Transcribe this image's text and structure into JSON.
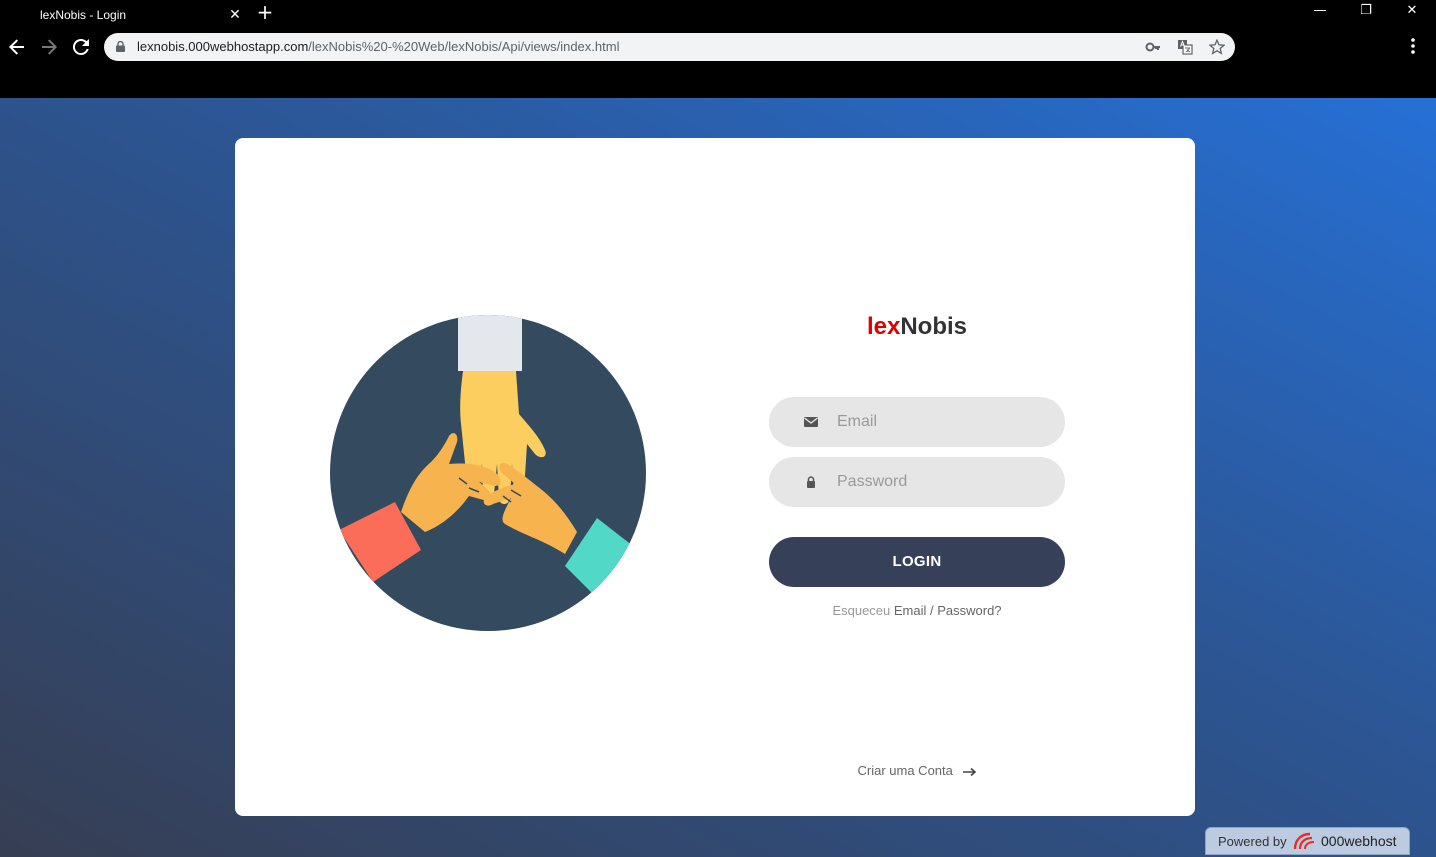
{
  "browser": {
    "tab_title": "lexNobis - Login",
    "tab_close": "✕",
    "new_tab": "+",
    "url_host": "lexnobis.000webhostapp.com",
    "url_path": "/lexNobis%20-%20Web/lexNobis/Api/views/index.html",
    "window_minimize": "—",
    "window_restore": "❐",
    "window_close": "✕"
  },
  "login": {
    "brand_red": "lex",
    "brand_dark": "Nobis",
    "email_placeholder": "Email",
    "password_placeholder": "Password",
    "login_label": "LOGIN",
    "forgot_prefix": "Esqueceu",
    "forgot_link": "Email / Password?",
    "create_account": "Criar uma Conta"
  },
  "footer": {
    "powered_by": "Powered by",
    "host_brand": "000webhost"
  },
  "colors": {
    "gradient_start": "#363e53",
    "gradient_end": "#2670d6",
    "button": "#364059",
    "brand_red": "#e00000",
    "illustration_bg": "#344a5e"
  },
  "icons": {
    "back": "arrow-left-icon",
    "forward": "arrow-right-icon",
    "reload": "reload-icon",
    "lock": "lock-icon",
    "key": "key-icon",
    "translate": "translate-icon",
    "star": "star-icon",
    "menu": "kebab-menu-icon",
    "email": "envelope-icon",
    "password": "padlock-icon",
    "arrow": "long-arrow-right-icon"
  }
}
